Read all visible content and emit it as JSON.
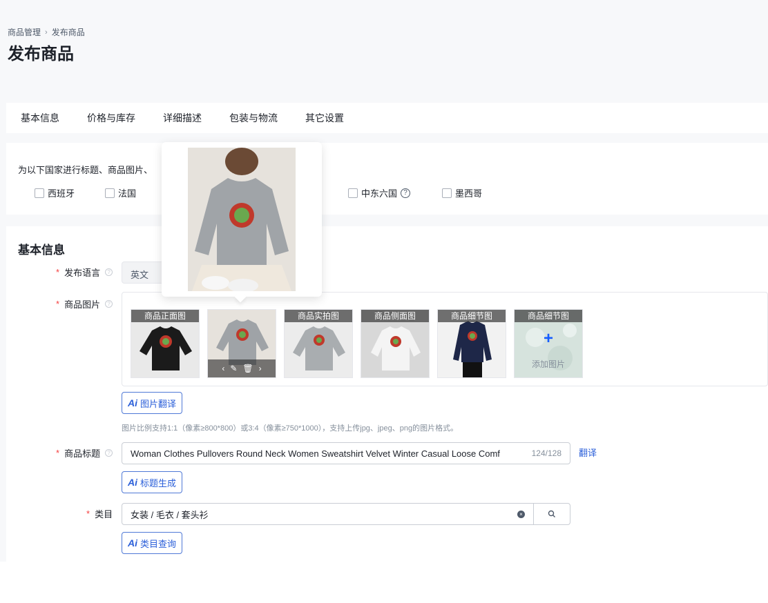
{
  "breadcrumb": {
    "root": "商品管理",
    "current": "发布商品"
  },
  "page_title": "发布商品",
  "tabs": [
    "基本信息",
    "价格与库存",
    "详细描述",
    "包装与物流",
    "其它设置"
  ],
  "country": {
    "desc": "为以下国家进行标题、商品图片、",
    "options": [
      "西班牙",
      "法国",
      "中东六国",
      "墨西哥"
    ]
  },
  "basic": {
    "section_title": "基本信息",
    "lang_label": "发布语言",
    "lang_value": "英文",
    "image_label": "商品图片",
    "images": [
      {
        "caption": "商品正面图",
        "color": "#1b1b1b"
      },
      {
        "caption": "",
        "color": "#9fa3a7"
      },
      {
        "caption": "商品实拍图",
        "color": "#a9adb0"
      },
      {
        "caption": "商品侧面图",
        "color": "#eeeeee"
      },
      {
        "caption": "商品细节图",
        "color": "#1e2748"
      },
      {
        "caption": "商品细节图",
        "color": "#d6e3dd"
      }
    ],
    "add_image": "添加图片",
    "img_translate_btn": "图片翻译",
    "hint": "图片比例支持1:1（像素≥800*800）或3:4（像素≥750*1000），支持上传jpg、jpeg、png的图片格式。",
    "title_label": "商品标题",
    "title_value": "Woman Clothes Pullovers Round Neck Women Sweatshirt Velvet Winter Casual Loose Comf",
    "title_count": "124/128",
    "translate": "翻译",
    "title_gen_btn": "标题生成",
    "category_label": "类目",
    "category_value": "女装 / 毛衣 / 套头衫",
    "category_query_btn": "类目查询"
  },
  "ai_mark": "Ai",
  "colors": {
    "accent": "#2b5fd9",
    "required": "#f53f3f",
    "page_bg": "#f7f8fa"
  }
}
